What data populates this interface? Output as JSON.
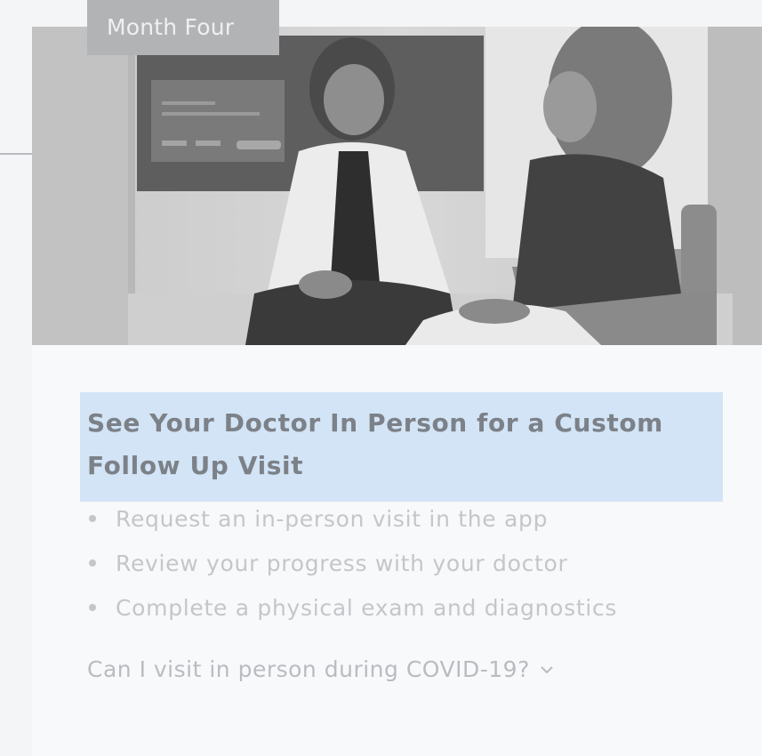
{
  "card": {
    "tag": "Month Four",
    "title": "See Your Doctor In Person for a Custom Follow Up Visit",
    "bullets": [
      "Request an in-person visit in the app",
      "Review your progress with your doctor",
      "Complete a physical exam and diagnostics"
    ],
    "faq_link": "Can I visit in person during COVID-19?"
  },
  "colors": {
    "highlight": "#d2e4f6",
    "title_text": "#7c8188",
    "muted_text": "#c4c6c9",
    "tag_background": "#b1b3b5"
  },
  "icons": {
    "faq_toggle": "chevron-down-icon"
  }
}
